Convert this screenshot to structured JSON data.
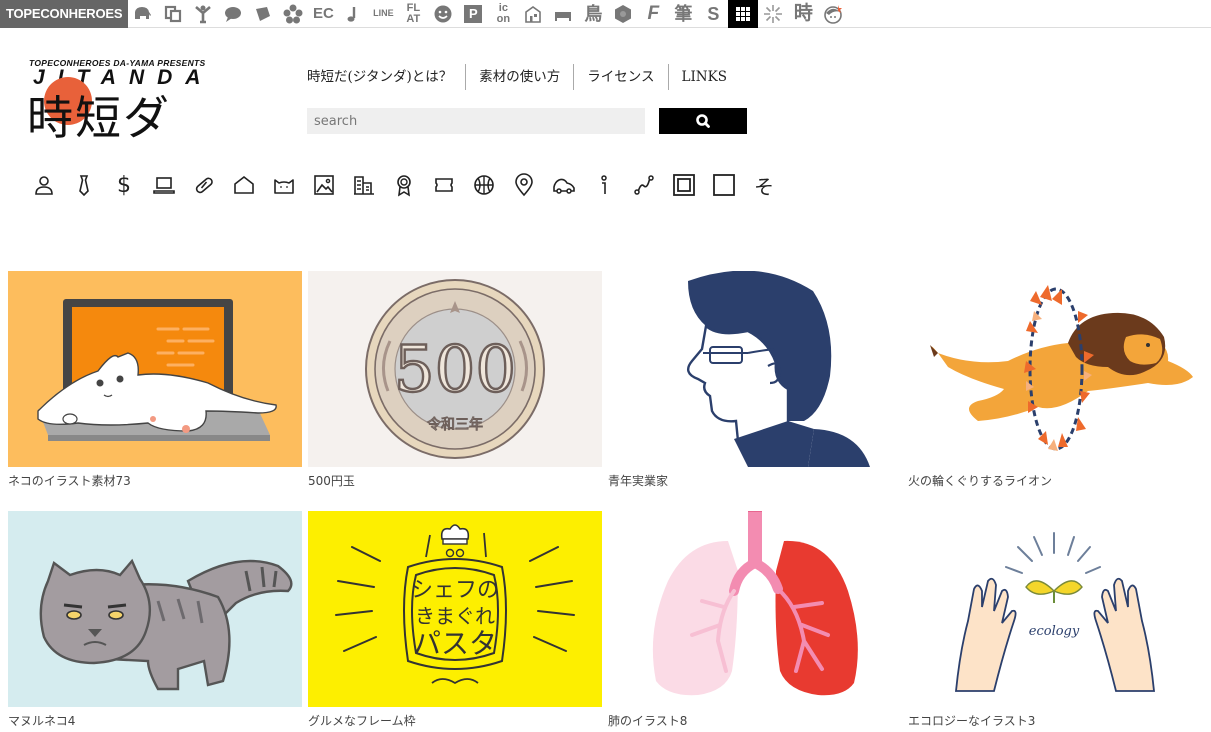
{
  "topbar": {
    "brand": "TOPECONHEROES",
    "text_sites": {
      "ec": "EC",
      "line": "LINE",
      "flat": "FL AT",
      "icon": "ic on",
      "p": "P",
      "f": "F",
      "fude": "筆",
      "s": "S",
      "toki": "時"
    }
  },
  "logo": {
    "presents": "TOPECONHEROES DA-YAMA PRESENTS",
    "name": "JITANDA",
    "kanji": "時短ダ"
  },
  "nav": [
    {
      "label": "時短だ(ジタンダ)とは？"
    },
    {
      "label": "素材の使い方"
    },
    {
      "label": "ライセンス"
    },
    {
      "label": "LINKS"
    }
  ],
  "search": {
    "placeholder": "search",
    "value": ""
  },
  "categories_last": "そ",
  "colors": {
    "accent_sun": "#e8613a",
    "thumb_cat": "#fdbd5d",
    "thumb_coin": "#f5f1ee",
    "thumb_manul": "#d5ecef",
    "thumb_frame": "#fdef00",
    "navy": "#2b3f6c"
  },
  "items": [
    {
      "caption": "ネコのイラスト素材73"
    },
    {
      "caption": "500円玉"
    },
    {
      "caption": "青年実業家"
    },
    {
      "caption": "火の輪くぐりするライオン"
    },
    {
      "caption": "マヌルネコ4"
    },
    {
      "caption": "グルメなフレーム枠"
    },
    {
      "caption": "肺のイラスト8"
    },
    {
      "caption": "エコロジーなイラスト3"
    }
  ],
  "art_text": {
    "coin_value": "500",
    "coin_era": "令和三年",
    "frame_line1": "シェフの",
    "frame_line2": "きまぐれ",
    "frame_line3": "パスタ",
    "eco_word": "ecology"
  }
}
